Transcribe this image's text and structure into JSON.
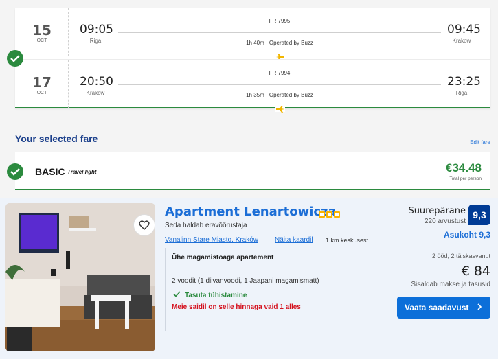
{
  "flights": [
    {
      "day": "15",
      "month": "OCT",
      "dep_time": "09:05",
      "dep_city": "Riga",
      "flight_no": "FR 7995",
      "duration": "1h 40m · Operated by Buzz",
      "arr_time": "09:45",
      "arr_city": "Krakow"
    },
    {
      "day": "17",
      "month": "OCT",
      "dep_time": "20:50",
      "dep_city": "Krakow",
      "flight_no": "FR 7994",
      "duration": "1h 35m · Operated by Buzz",
      "arr_time": "23:25",
      "arr_city": "Riga"
    }
  ],
  "fare": {
    "heading": "Your selected fare",
    "edit_link": "Edit fare",
    "name": "BASIC",
    "tag": "Travel light",
    "price": "€34.48",
    "per": "Total per person"
  },
  "hotel": {
    "name": "Apartment Lenartowicza",
    "stars": 3,
    "managed_by": "Seda haldab eravõõrustaja",
    "location": "Vanalinn Stare Miasto, Kraków",
    "map_link": "Näita kaardil",
    "distance": "1 km keskusest",
    "room_type": "Ühe magamistoaga apartement",
    "beds": "2 voodit (1 diivanvoodi, 1 Jaapani magamismatt)",
    "cancellation": "Tasuta tühistamine",
    "scarcity": "Meie saidil on selle hinnaga vaid 1 alles",
    "score_word": "Suurepärane",
    "review_count": "220 arvustust",
    "score": "9,3",
    "location_score": "Asukoht 9,3",
    "stay_info": "2 ööd, 2 täiskasvanut",
    "price": "€ 84",
    "taxes": "Sisaldab makse ja tasusid",
    "availability_button": "Vaata saadavust"
  },
  "colors": {
    "accent_green": "#2b8a3e",
    "link_blue": "#1c6ed6",
    "heading_navy": "#1b3f8b",
    "score_badge": "#003b95",
    "alert_red": "#d4111e",
    "star_yellow": "#fbb400"
  }
}
